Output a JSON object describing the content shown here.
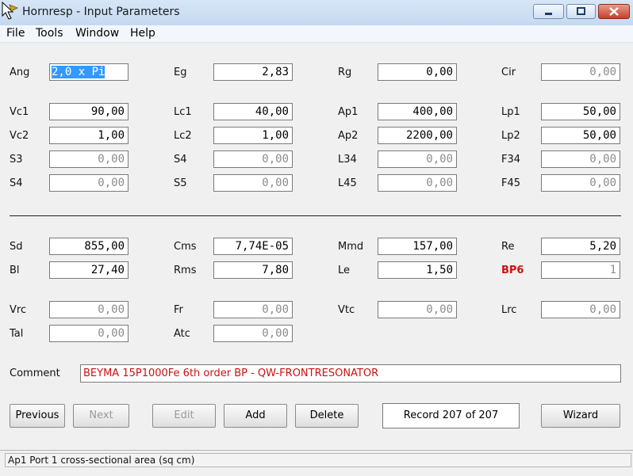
{
  "window": {
    "title": "Hornresp - Input Parameters"
  },
  "menu": [
    "File",
    "Tools",
    "Window",
    "Help"
  ],
  "rows": [
    {
      "label": "Ang",
      "value": "2,0 x Pi",
      "selected": true
    },
    {
      "label": "Eg",
      "value": "2,83"
    },
    {
      "label": "Rg",
      "value": "0,00"
    },
    {
      "label": "Cir",
      "value": "0,00",
      "disabled": true
    },
    {
      "label": "Vc1",
      "value": "90,00"
    },
    {
      "label": "Lc1",
      "value": "40,00"
    },
    {
      "label": "Ap1",
      "value": "400,00"
    },
    {
      "label": "Lp1",
      "value": "50,00"
    },
    {
      "label": "Vc2",
      "value": "1,00"
    },
    {
      "label": "Lc2",
      "value": "1,00"
    },
    {
      "label": "Ap2",
      "value": "2200,00"
    },
    {
      "label": "Lp2",
      "value": "50,00"
    },
    {
      "label": "S3",
      "value": "0,00",
      "disabled": true
    },
    {
      "label": "S4",
      "value": "0,00",
      "disabled": true
    },
    {
      "label": "L34",
      "value": "0,00",
      "disabled": true
    },
    {
      "label": "F34",
      "value": "0,00",
      "disabled": true
    },
    {
      "label": "S4",
      "value": "0,00",
      "disabled": true
    },
    {
      "label": "S5",
      "value": "0,00",
      "disabled": true
    },
    {
      "label": "L45",
      "value": "0,00",
      "disabled": true
    },
    {
      "label": "F45",
      "value": "0,00",
      "disabled": true
    },
    {
      "label": "Sd",
      "value": "855,00"
    },
    {
      "label": "Cms",
      "value": "7,74E-05"
    },
    {
      "label": "Mmd",
      "value": "157,00"
    },
    {
      "label": "Re",
      "value": "5,20"
    },
    {
      "label": "Bl",
      "value": "27,40"
    },
    {
      "label": "Rms",
      "value": "7,80"
    },
    {
      "label": "Le",
      "value": "1,50"
    },
    {
      "label": "BP6",
      "value": "1",
      "disabled": true,
      "red": true
    },
    {
      "label": "Vrc",
      "value": "0,00",
      "disabled": true
    },
    {
      "label": "Fr",
      "value": "0,00",
      "disabled": true
    },
    {
      "label": "Vtc",
      "value": "0,00",
      "disabled": true
    },
    {
      "label": "Lrc",
      "value": "0,00",
      "disabled": true
    },
    {
      "label": "Tal",
      "value": "0,00",
      "disabled": true
    },
    {
      "label": "Atc",
      "value": "0,00",
      "disabled": true
    }
  ],
  "comment": {
    "label": "Comment",
    "value": "BEYMA 15P1000Fe 6th order BP - QW-FRONTRESONATOR"
  },
  "buttons": {
    "previous": "Previous",
    "next": "Next",
    "edit": "Edit",
    "add": "Add",
    "delete": "Delete",
    "wizard": "Wizard"
  },
  "record": "Record 207 of 207",
  "status": "Ap1   Port 1 cross-sectional area  (sq cm)"
}
